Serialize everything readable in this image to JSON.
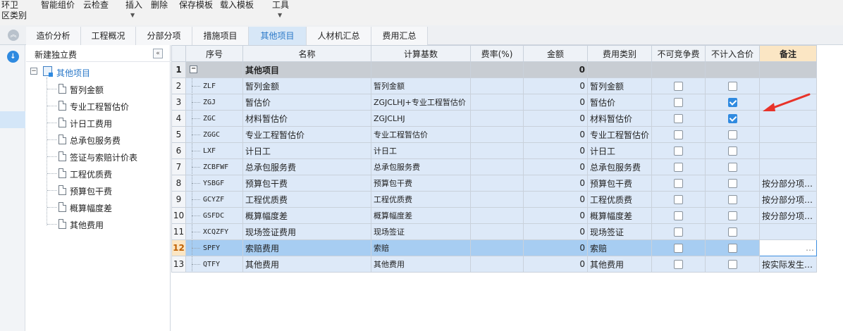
{
  "toolbar": {
    "left_title_line1": "环卫",
    "left_title_line2": "区类别",
    "items": [
      "智能组价",
      "云检查",
      "插入",
      "删除",
      "保存模板",
      "载入模板",
      "工具"
    ]
  },
  "tabs": [
    "造价分析",
    "工程概况",
    "分部分项",
    "措施项目",
    "其他项目",
    "人材机汇总",
    "费用汇总"
  ],
  "active_tab": "其他项目",
  "tree": {
    "title": "新建独立费",
    "collapse_symbol": "«",
    "root": "其他项目",
    "items": [
      "暂列金额",
      "专业工程暂估价",
      "计日工费用",
      "总承包服务费",
      "签证与索赔计价表",
      "工程优质费",
      "预算包干费",
      "概算幅度差",
      "其他费用"
    ]
  },
  "grid": {
    "columns": [
      "序号",
      "名称",
      "计算基数",
      "费率(%)",
      "金额",
      "费用类别",
      "不可竞争费",
      "不计入合价",
      "备注"
    ],
    "rows": [
      {
        "no": "1",
        "code": "",
        "name": "其他项目",
        "base": "",
        "rate": "",
        "amount": "0",
        "category": "",
        "noncomp": null,
        "exclude": null,
        "note": "",
        "group": true
      },
      {
        "no": "2",
        "code": "ZLF",
        "name": "暂列金额",
        "base": "暂列金额",
        "rate": "",
        "amount": "0",
        "category": "暂列金额",
        "noncomp": false,
        "exclude": false,
        "note": ""
      },
      {
        "no": "3",
        "code": "ZGJ",
        "name": "暂估价",
        "base": "ZGJCLHJ+专业工程暂估价",
        "rate": "",
        "amount": "0",
        "category": "暂估价",
        "noncomp": false,
        "exclude": true,
        "note": ""
      },
      {
        "no": "4",
        "code": "ZGC",
        "name": "材料暂估价",
        "base": "ZGJCLHJ",
        "rate": "",
        "amount": "0",
        "category": "材料暂估价",
        "noncomp": false,
        "exclude": true,
        "note": ""
      },
      {
        "no": "5",
        "code": "ZGGC",
        "name": "专业工程暂估价",
        "base": "专业工程暂估价",
        "rate": "",
        "amount": "0",
        "category": "专业工程暂估价",
        "noncomp": false,
        "exclude": false,
        "note": ""
      },
      {
        "no": "6",
        "code": "LXF",
        "name": "计日工",
        "base": "计日工",
        "rate": "",
        "amount": "0",
        "category": "计日工",
        "noncomp": false,
        "exclude": false,
        "note": ""
      },
      {
        "no": "7",
        "code": "ZCBFWF",
        "name": "总承包服务费",
        "base": "总承包服务费",
        "rate": "",
        "amount": "0",
        "category": "总承包服务费",
        "noncomp": false,
        "exclude": false,
        "note": ""
      },
      {
        "no": "8",
        "code": "YSBGF",
        "name": "预算包干费",
        "base": "预算包干费",
        "rate": "",
        "amount": "0",
        "category": "预算包干费",
        "noncomp": false,
        "exclude": false,
        "note": "按分部分项…"
      },
      {
        "no": "9",
        "code": "GCYZF",
        "name": "工程优质费",
        "base": "工程优质费",
        "rate": "",
        "amount": "0",
        "category": "工程优质费",
        "noncomp": false,
        "exclude": false,
        "note": "按分部分项…"
      },
      {
        "no": "10",
        "code": "GSFDC",
        "name": "概算幅度差",
        "base": "概算幅度差",
        "rate": "",
        "amount": "0",
        "category": "概算幅度差",
        "noncomp": false,
        "exclude": false,
        "note": "按分部分项…"
      },
      {
        "no": "11",
        "code": "XCQZFY",
        "name": "现场签证费用",
        "base": "现场签证",
        "rate": "",
        "amount": "0",
        "category": "现场签证",
        "noncomp": false,
        "exclude": false,
        "note": ""
      },
      {
        "no": "12",
        "code": "SPFY",
        "name": "索赔费用",
        "base": "索赔",
        "rate": "",
        "amount": "0",
        "category": "索赔",
        "noncomp": false,
        "exclude": false,
        "note": "…",
        "selected": true
      },
      {
        "no": "13",
        "code": "QTFY",
        "name": "其他费用",
        "base": "其他费用",
        "rate": "",
        "amount": "0",
        "category": "其他费用",
        "noncomp": false,
        "exclude": false,
        "note": "按实际发生…"
      }
    ]
  },
  "colors": {
    "accent": "#2f8ae0",
    "row_bg": "#dde9f8",
    "selected_row_bg": "#a7cdf2",
    "note_header_bg": "#fbe6c4",
    "annotation_arrow": "#e8332a"
  },
  "icons": {
    "collapse_up": "double-chevron-up-icon",
    "download": "down-arrow-circle-icon",
    "tree_root": "folder-icon",
    "tree_item": "document-icon",
    "annotation": "red-arrow-icon"
  }
}
